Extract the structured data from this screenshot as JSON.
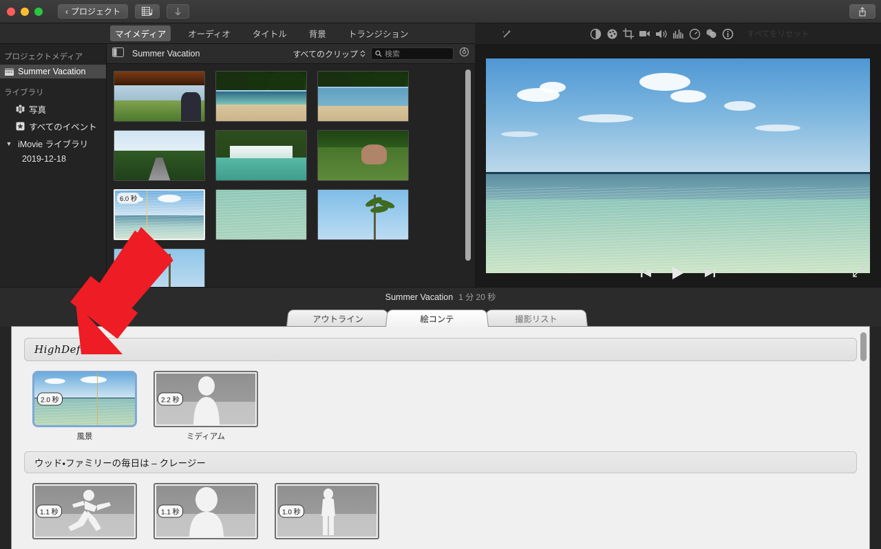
{
  "window": {
    "back_button": "プロジェクト",
    "back_chevron": "‹",
    "music_button_icon": "media-music-icon",
    "download_button_icon": "download-arrow-icon",
    "share_button_icon": "share-export-icon",
    "traffic_lights": [
      "close",
      "minimize",
      "zoom"
    ]
  },
  "media_tabs": [
    {
      "label": "マイメディア",
      "active": true
    },
    {
      "label": "オーディオ",
      "active": false
    },
    {
      "label": "タイトル",
      "active": false
    },
    {
      "label": "背景",
      "active": false
    },
    {
      "label": "トランジション",
      "active": false
    }
  ],
  "sidebar": {
    "section_project": "プロジェクトメディア",
    "project_item": "Summer Vacation",
    "section_library": "ライブラリ",
    "items": [
      {
        "label": "写真",
        "icon": "photos-icon"
      },
      {
        "label": "すべてのイベント",
        "icon": "star-events-icon"
      },
      {
        "label": "iMovie ライブラリ",
        "icon": "disclosure-triangle-icon"
      },
      {
        "label": "2019-12-18",
        "icon": "event-icon"
      }
    ]
  },
  "browser_header": {
    "sidebar_toggle_icon": "sidebar-toggle-icon",
    "title": "Summer Vacation",
    "filter_label": "すべてのクリップ",
    "filter_chevron": "⌃⌄",
    "search_icon": "search-icon",
    "search_placeholder": "検索",
    "settings_icon": "gear-icon"
  },
  "media_grid": {
    "clips": [
      {
        "name": "bus-window-greenfield",
        "duration": ""
      },
      {
        "name": "beach-cove-trees",
        "duration": ""
      },
      {
        "name": "beach-shoreline-wide",
        "duration": ""
      },
      {
        "name": "tropical-road",
        "duration": ""
      },
      {
        "name": "waterfall-lagoon",
        "duration": ""
      },
      {
        "name": "cow-in-field",
        "duration": ""
      },
      {
        "name": "ocean-horizon-clouds",
        "duration": "6.0 秒",
        "selected": true
      },
      {
        "name": "shallow-turquoise-water",
        "duration": ""
      },
      {
        "name": "palm-tree-sky",
        "duration": ""
      },
      {
        "name": "palms-against-sky",
        "duration": ""
      }
    ]
  },
  "viewer_toolbar": {
    "icons": [
      "magic-wand-icon",
      "color-balance-icon",
      "color-correction-icon",
      "crop-icon",
      "stabilization-icon",
      "volume-icon",
      "equalizer-icon",
      "speed-icon",
      "filter-icon",
      "info-icon"
    ],
    "reset_label": "すべてをリセット"
  },
  "viewer": {
    "scene": "ocean-horizon-clouds",
    "playback": {
      "skip_back_icon": "skip-back-icon",
      "play_icon": "play-icon",
      "skip_forward_icon": "skip-forward-icon",
      "fullscreen_icon": "fullscreen-expand-icon"
    }
  },
  "project_bar": {
    "title": "Summer Vacation",
    "duration": "1 分 20 秒"
  },
  "storyboard_tabs": [
    {
      "label": "アウトライン",
      "active": false
    },
    {
      "label": "絵コンテ",
      "active": true
    },
    {
      "label": "撮影リスト",
      "active": false
    }
  ],
  "storyboard": {
    "title_field_value": "HighDef Films",
    "sections": [
      {
        "heading": "",
        "clips": [
          {
            "duration": "2.0 秒",
            "label": "風景",
            "kind": "filled",
            "selected": true
          },
          {
            "duration": "2.2 秒",
            "label": "ミディアム",
            "kind": "placeholder",
            "silhouette": "person-medium"
          }
        ]
      },
      {
        "heading": "ウッド・ファミリーの毎日は – クレージー",
        "clips": [
          {
            "duration": "1.1 秒",
            "label": "",
            "kind": "placeholder",
            "silhouette": "person-running"
          },
          {
            "duration": "1.1 秒",
            "label": "",
            "kind": "placeholder",
            "silhouette": "person-closeup"
          },
          {
            "duration": "1.0 秒",
            "label": "",
            "kind": "placeholder",
            "silhouette": "person-wide"
          }
        ]
      }
    ]
  },
  "annotation": {
    "arrow_color": "#ee1c24",
    "arrow_target": "storyboard-title-field"
  }
}
